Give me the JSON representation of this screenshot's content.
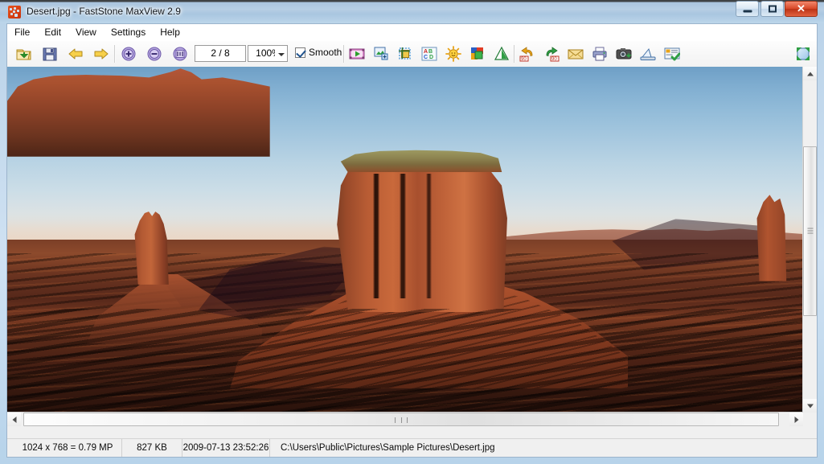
{
  "window": {
    "title": "Desert.jpg - FastStone MaxView 2.9",
    "app_icon": "faststone-icon",
    "controls": {
      "minimize": "minimize-button",
      "maximize": "maximize-button",
      "close_glyph": "✕"
    }
  },
  "menu": {
    "items": [
      {
        "label": "File"
      },
      {
        "label": "Edit"
      },
      {
        "label": "View"
      },
      {
        "label": "Settings"
      },
      {
        "label": "Help"
      }
    ]
  },
  "toolbar": {
    "page_counter": "2 / 8",
    "zoom_level": "100%",
    "smooth_label": "Smooth",
    "smooth_checked": true,
    "buttons": [
      {
        "name": "open-button",
        "tip": "Open"
      },
      {
        "name": "save-button",
        "tip": "Save As"
      },
      {
        "name": "previous-image-button",
        "tip": "Previous Image"
      },
      {
        "name": "next-image-button",
        "tip": "Next Image"
      },
      {
        "name": "zoom-in-button",
        "tip": "Zoom In"
      },
      {
        "name": "zoom-out-button",
        "tip": "Zoom Out"
      },
      {
        "name": "actual-size-button",
        "tip": "Actual Size"
      },
      {
        "name": "slideshow-button",
        "tip": "Slide Show"
      },
      {
        "name": "resize-button",
        "tip": "Resize / Resample"
      },
      {
        "name": "crop-button",
        "tip": "Crop"
      },
      {
        "name": "text-button",
        "tip": "Draw Board / Text"
      },
      {
        "name": "brightness-button",
        "tip": "Adjust Lighting"
      },
      {
        "name": "colors-button",
        "tip": "Adjust Colors"
      },
      {
        "name": "sharpen-button",
        "tip": "Sharpen / Blur"
      },
      {
        "name": "rotate-left-button",
        "tip": "Rotate Left 90"
      },
      {
        "name": "rotate-right-button",
        "tip": "Rotate Right 90"
      },
      {
        "name": "email-button",
        "tip": "E-mail"
      },
      {
        "name": "print-button",
        "tip": "Print"
      },
      {
        "name": "capture-button",
        "tip": "Screen Capture"
      },
      {
        "name": "scan-button",
        "tip": "Acquire from Scanner"
      },
      {
        "name": "properties-button",
        "tip": "File Properties"
      },
      {
        "name": "fullscreen-button",
        "tip": "Full Screen"
      }
    ]
  },
  "image": {
    "name": "Desert.jpg",
    "subject": "Monument Valley buttes at sunset",
    "palette": {
      "sky_top": "#6e9fc6",
      "sky_bottom": "#edded1",
      "butte_lit": "#c9693b",
      "butte_shadow": "#6d3620",
      "cap_rock": "#9e9a62",
      "valley_floor": "#56281a",
      "deep_shadow": "#2a120b"
    }
  },
  "scrollbars": {
    "vertical": {
      "thumb_top_pct": 23,
      "thumb_height_pct": 49
    },
    "horizontal": {
      "thumb_left_pct": 2,
      "thumb_width_pct": 95
    }
  },
  "statusbar": {
    "dimensions": "1024 x 768 = 0.79 MP",
    "filesize": "827 KB",
    "datetime": "2009-07-13 23:52:26",
    "path": "C:\\Users\\Public\\Pictures\\Sample Pictures\\Desert.jpg"
  }
}
